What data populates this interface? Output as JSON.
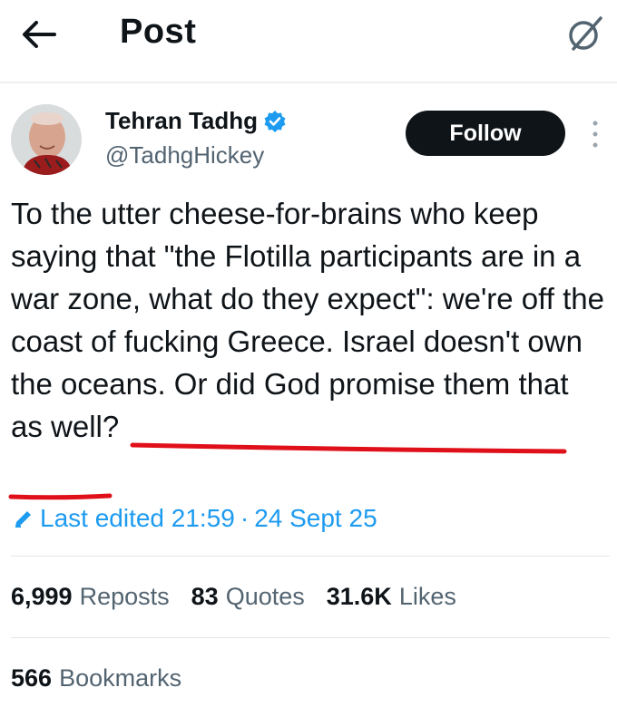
{
  "header": {
    "title": "Post",
    "back_icon": "arrow-left-icon",
    "action_icon": "grok-icon"
  },
  "author": {
    "name": "Tehran Tadhg",
    "handle": "@TadhgHickey",
    "verified": true,
    "verified_color": "#1d9bf0"
  },
  "follow_label": "Follow",
  "tweet": {
    "text_before": "To the utter cheese-for-brains who keep saying that \"the Flotilla participants are in a war zone, what do they expect\": we're off the coast of fucking Greece. Israel doesn't own the oceans. ",
    "text_underlined": "Or did God promise them that as well?",
    "underline_color": "#e0101a"
  },
  "edited": {
    "label": "Last edited",
    "time": "21:59",
    "separator": "·",
    "date": "24 Sept 25",
    "color": "#1d9bf0"
  },
  "stats": {
    "reposts": {
      "value": "6,999",
      "label": "Reposts"
    },
    "quotes": {
      "value": "83",
      "label": "Quotes"
    },
    "likes": {
      "value": "31.6K",
      "label": "Likes"
    },
    "bookmarks": {
      "value": "566",
      "label": "Bookmarks"
    }
  }
}
